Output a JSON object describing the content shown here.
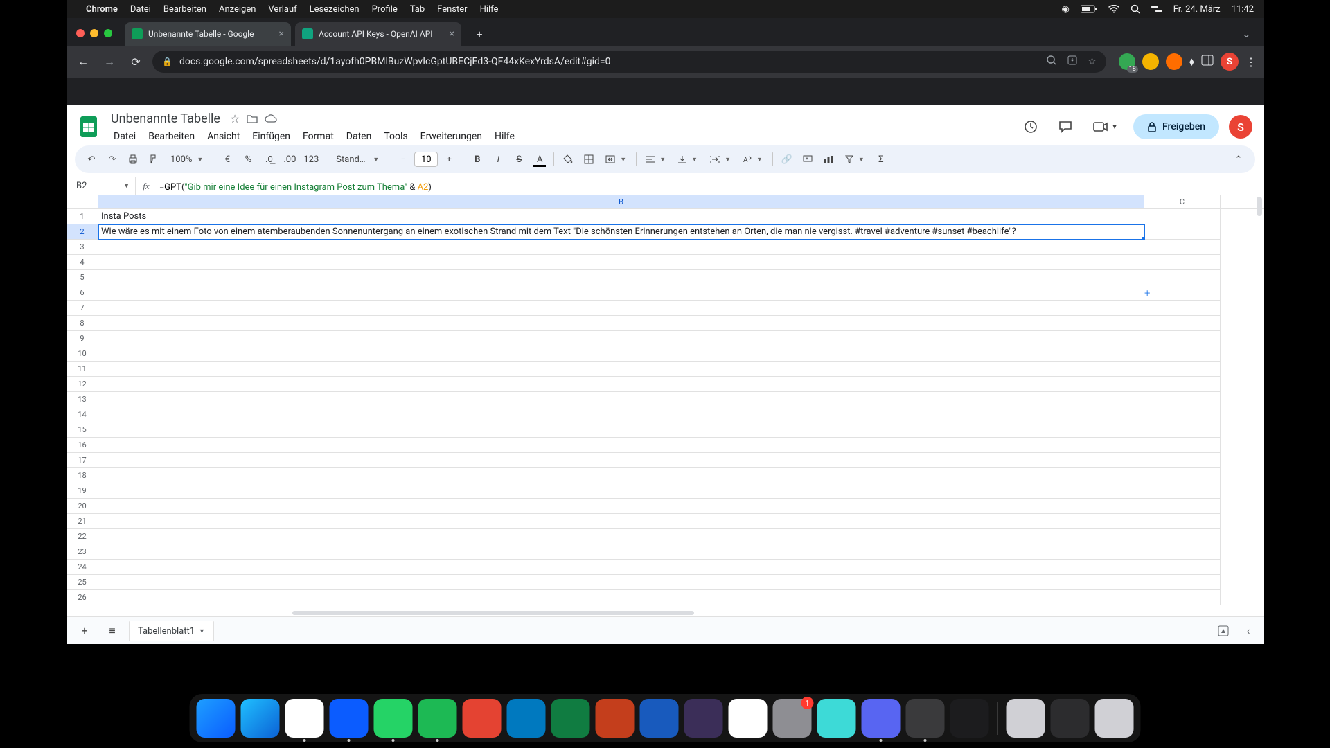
{
  "mac_menu": {
    "app": "Chrome",
    "items": [
      "Datei",
      "Bearbeiten",
      "Anzeigen",
      "Verlauf",
      "Lesezeichen",
      "Profile",
      "Tab",
      "Fenster",
      "Hilfe"
    ],
    "date": "Fr. 24. März",
    "time": "11:42"
  },
  "chrome": {
    "tabs": [
      {
        "title": "Unbenannte Tabelle - Google",
        "active": true
      },
      {
        "title": "Account API Keys - OpenAI API",
        "active": false
      }
    ],
    "url": "docs.google.com/spreadsheets/d/1ayofh0PBMlBuzWpvIcGptUBECjEd3-QF44xKexYrdsA/edit#gid=0",
    "ext_badge": "18",
    "avatar_letter": "S"
  },
  "sheets": {
    "doc_title": "Unbenannte Tabelle",
    "menus": [
      "Datei",
      "Bearbeiten",
      "Ansicht",
      "Einfügen",
      "Format",
      "Daten",
      "Tools",
      "Erweiterungen",
      "Hilfe"
    ],
    "share_label": "Freigeben",
    "avatar_letter": "S",
    "toolbar": {
      "zoom": "100%",
      "font_name": "Stand…",
      "font_size": "10",
      "num_format": "123"
    },
    "name_box": "B2",
    "formula": {
      "prefix": "=",
      "fn": "GPT",
      "open": "(",
      "str": "\"Gib mir eine Idee für einen Instagram Post zum Thema\"",
      "amp": " & ",
      "ref": "A2",
      "close": ")"
    },
    "columns": [
      "B",
      "C"
    ],
    "row_headers": [
      1,
      2,
      3,
      4,
      5,
      6,
      7,
      8,
      9,
      10,
      11,
      12,
      13,
      14,
      15,
      16,
      17,
      18,
      19,
      20,
      21,
      22,
      23,
      24,
      25,
      26
    ],
    "cells": {
      "B1": "Insta Posts",
      "B2": "Wie wäre es mit einem Foto von einem atemberaubenden Sonnenuntergang an einem exotischen Strand mit dem Text \"Die schönsten Erinnerungen entstehen an Orten, die man nie vergisst. #travel #adventure #sunset #beachlife\"?"
    },
    "active_cell": "B2",
    "sheet_tab": "Tabellenblatt1"
  },
  "dock": {
    "apps": [
      {
        "name": "finder",
        "bg": "linear-gradient(135deg,#1e9fff,#0a5cff)"
      },
      {
        "name": "safari",
        "bg": "linear-gradient(135deg,#20c0ff,#0b62d6)"
      },
      {
        "name": "chrome",
        "bg": "#fff",
        "running": true
      },
      {
        "name": "zoom",
        "bg": "#0b5cff",
        "running": true
      },
      {
        "name": "whatsapp",
        "bg": "#25d366",
        "running": true
      },
      {
        "name": "spotify",
        "bg": "#1db954",
        "running": true
      },
      {
        "name": "todoist",
        "bg": "#e44332"
      },
      {
        "name": "trello",
        "bg": "#0079bf"
      },
      {
        "name": "excel",
        "bg": "#107c41"
      },
      {
        "name": "powerpoint",
        "bg": "#c43e1c"
      },
      {
        "name": "word",
        "bg": "#185abd"
      },
      {
        "name": "imovie",
        "bg": "#3b2e58"
      },
      {
        "name": "drive",
        "bg": "#fff"
      },
      {
        "name": "settings",
        "bg": "#8e8e93",
        "badge": "1"
      },
      {
        "name": "app-teal",
        "bg": "#3ddad7"
      },
      {
        "name": "discord",
        "bg": "#5865f2",
        "running": true
      },
      {
        "name": "quicktime",
        "bg": "#3a3a3c",
        "running": true
      },
      {
        "name": "voice-memos",
        "bg": "#1c1c1e"
      }
    ],
    "right": [
      {
        "name": "preview",
        "bg": "#d0d0d5"
      },
      {
        "name": "mission",
        "bg": "#2c2c2e"
      },
      {
        "name": "trash",
        "bg": "#d0d0d5"
      }
    ]
  }
}
